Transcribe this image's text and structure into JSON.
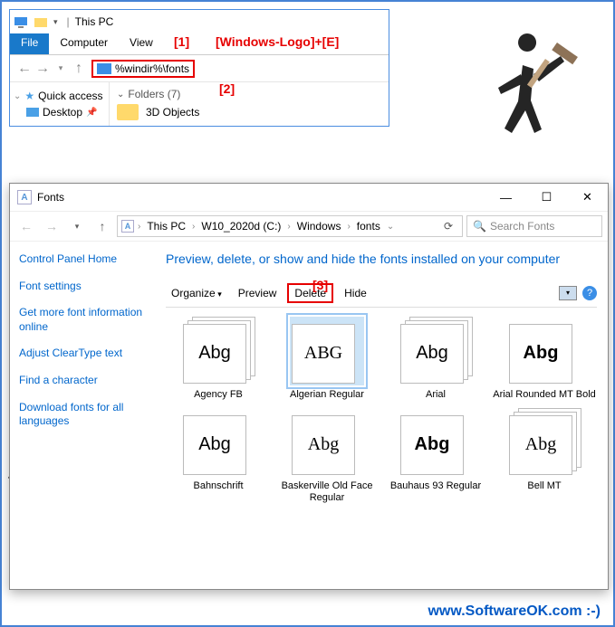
{
  "win1": {
    "title": "This PC",
    "tabs": {
      "file": "File",
      "computer": "Computer",
      "view": "View"
    },
    "address": "%windir%\\fonts",
    "quick_access": "Quick access",
    "desktop": "Desktop",
    "folders_hdr": "Folders (7)",
    "folder_3d": "3D Objects"
  },
  "annot": {
    "a1_num": "[1]",
    "a1_text": "[Windows-Logo]+[E]",
    "a2": "[2]",
    "a3": "[3]"
  },
  "win2": {
    "title": "Fonts",
    "path": [
      "This PC",
      "W10_2020d (C:)",
      "Windows",
      "fonts"
    ],
    "search_placeholder": "Search Fonts",
    "sidebar": {
      "home": "Control Panel Home",
      "settings": "Font settings",
      "moreinfo": "Get more font information online",
      "cleartype": "Adjust ClearType text",
      "findchar": "Find a character",
      "download": "Download fonts for all languages"
    },
    "main_title": "Preview, delete, or show and hide the fonts installed on your computer",
    "toolbar": {
      "organize": "Organize",
      "preview": "Preview",
      "delete": "Delete",
      "hide": "Hide"
    },
    "fonts": [
      {
        "name": "Agency FB",
        "sample": "Abg",
        "style": "font-family:'Agency FB',sans-serif;font-stretch:condensed"
      },
      {
        "name": "Algerian Regular",
        "sample": "ABG",
        "style": "font-family:'Algerian',serif;font-variant:small-caps",
        "selected": true,
        "single": true
      },
      {
        "name": "Arial",
        "sample": "Abg",
        "style": "font-family:Arial,sans-serif"
      },
      {
        "name": "Arial Rounded MT Bold",
        "sample": "Abg",
        "style": "font-family:'Arial Rounded MT Bold',sans-serif;font-weight:bold",
        "single": true
      },
      {
        "name": "Bahnschrift",
        "sample": "Abg",
        "style": "font-family:Bahnschrift,sans-serif",
        "single": true
      },
      {
        "name": "Baskerville Old Face Regular",
        "sample": "Abg",
        "style": "font-family:'Baskerville Old Face',serif",
        "single": true
      },
      {
        "name": "Bauhaus 93 Regular",
        "sample": "Abg",
        "style": "font-family:'Bauhaus 93',sans-serif;font-weight:bold",
        "single": true
      },
      {
        "name": "Bell MT",
        "sample": "Abg",
        "style": "font-family:'Bell MT',serif"
      }
    ]
  },
  "footer": "www.SoftwareOK.com :-)",
  "watermark": "SoftwareOK.com"
}
